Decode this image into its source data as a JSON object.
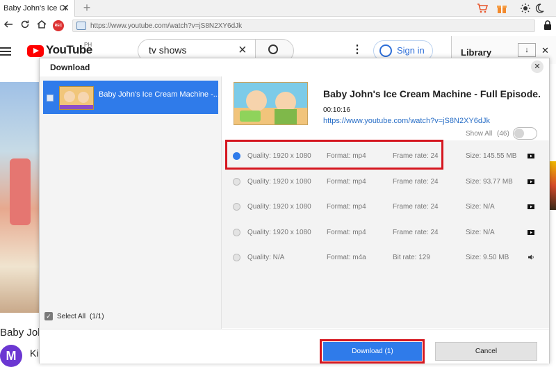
{
  "browser": {
    "tab_title": "Baby John's Ice Cr",
    "tab_close": "✕",
    "new_tab": "+",
    "url": "https://www.youtube.com/watch?v=jS8N2XY6dJk",
    "rec_label": "REC"
  },
  "youtube": {
    "logo_text": "YouTube",
    "region": "PH",
    "search_value": "tv shows",
    "sign_in": "Sign in",
    "side_panel_title": "Library",
    "video_title_partial": "Baby Jol",
    "avatar_letter": "M",
    "channel_partial": "Ki"
  },
  "dialog": {
    "title": "Download",
    "close": "✕",
    "list_item_title": "Baby John's Ice Cream Machine -...",
    "select_all_label": "Select All",
    "select_all_count": "(1/1)",
    "video_title": "Baby John's Ice Cream Machine - Full Episode.",
    "duration": "00:10:16",
    "video_url": "https://www.youtube.com/watch?v=jS8N2XY6dJk",
    "show_all_label": "Show All",
    "show_all_count": "(46)",
    "formats": [
      {
        "quality": "Quality: 1920 x 1080",
        "format": "Format: mp4",
        "rate": "Frame rate: 24",
        "size": "Size: 145.55 MB",
        "selected": true,
        "icon": "video-icon"
      },
      {
        "quality": "Quality: 1920 x 1080",
        "format": "Format: mp4",
        "rate": "Frame rate: 24",
        "size": "Size: 93.77 MB",
        "selected": false,
        "icon": "video-icon"
      },
      {
        "quality": "Quality: 1920 x 1080",
        "format": "Format: mp4",
        "rate": "Frame rate: 24",
        "size": "Size: N/A",
        "selected": false,
        "icon": "video-icon"
      },
      {
        "quality": "Quality: 1920 x 1080",
        "format": "Format: mp4",
        "rate": "Frame rate: 24",
        "size": "Size: N/A",
        "selected": false,
        "icon": "video-icon"
      },
      {
        "quality": "Quality: N/A",
        "format": "Format: m4a",
        "rate": "Bit rate: 129",
        "size": "Size: 9.50 MB",
        "selected": false,
        "icon": "audio-icon"
      }
    ],
    "download_button": "Download (1)",
    "cancel_button": "Cancel"
  },
  "colors": {
    "accent_blue": "#2f7bea",
    "highlight_red": "#d5161f",
    "youtube_red": "#ff0000"
  }
}
